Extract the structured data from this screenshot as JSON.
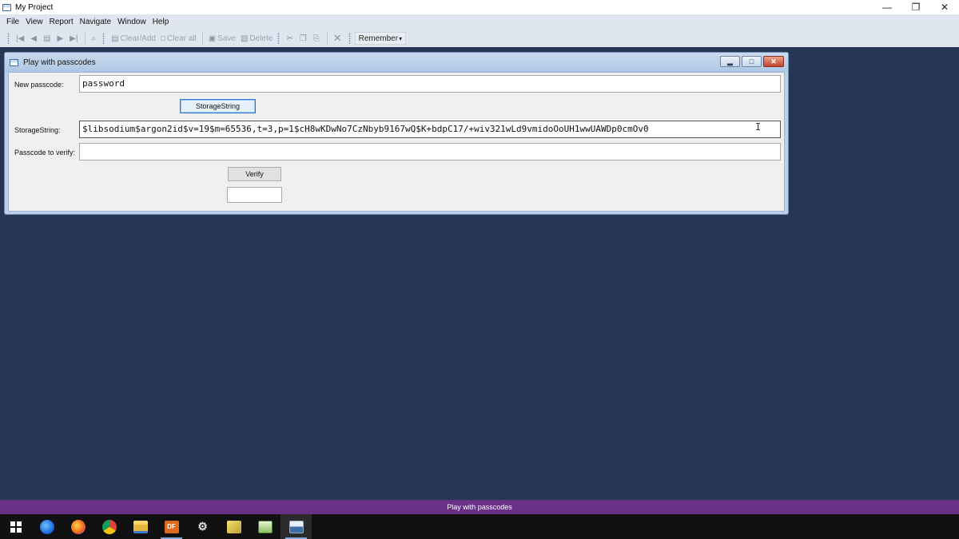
{
  "app": {
    "title": "My Project",
    "window_buttons": {
      "minimize": "—",
      "restore": "❐",
      "close": "✕"
    }
  },
  "menu": [
    "File",
    "View",
    "Report",
    "Navigate",
    "Window",
    "Help"
  ],
  "toolbar": {
    "nav": [
      {
        "name": "first-record-icon",
        "glyph": "|◀"
      },
      {
        "name": "prev-record-icon",
        "glyph": "◀"
      },
      {
        "name": "record-list-icon",
        "glyph": "▤"
      },
      {
        "name": "next-record-icon",
        "glyph": "▶"
      },
      {
        "name": "last-record-icon",
        "glyph": "▶|"
      }
    ],
    "search_glyph": "🔍",
    "clear_add": "Clear/Add",
    "clear_all": "Clear all",
    "save": "Save",
    "delete": "Delete",
    "remember": "Remember",
    "remember_caret": "▾"
  },
  "form": {
    "title": "Play with passcodes",
    "new_passcode_label": "New passcode:",
    "new_passcode_value": "password",
    "storage_button": "StorageString",
    "storage_label": "StorageString:",
    "storage_value": "$libsodium$argon2id$v=19$m=65536,t=3,p=1$cH8wKDwNo7CzNbyb9167wQ$K+bdpC17/+wiv321wLd9vmidoOoUH1wwUAWDp0cmOv0",
    "verify_label": "Passcode to verify:",
    "verify_value": "",
    "verify_button": "Verify",
    "result_value": ""
  },
  "statusbar": {
    "text": "Play with passcodes"
  },
  "taskbar": {
    "apps": [
      {
        "name": "start-icon",
        "color": "#ffffff"
      },
      {
        "name": "firefox-developer-icon",
        "color": "#1d6fe0"
      },
      {
        "name": "firefox-icon",
        "color": "#f26b1d"
      },
      {
        "name": "chrome-icon",
        "color": "#f4c20d"
      },
      {
        "name": "file-explorer-icon",
        "color": "#f2c04b"
      },
      {
        "name": "dataflex-icon",
        "color": "#e06a1c",
        "text": "DF"
      },
      {
        "name": "studio-icon",
        "color": "#d0d0d0"
      },
      {
        "name": "tool-icon",
        "color": "#d8c040"
      },
      {
        "name": "notepad-icon",
        "color": "#88c060"
      },
      {
        "name": "my-project-icon",
        "color": "#3a6ea5"
      }
    ]
  }
}
